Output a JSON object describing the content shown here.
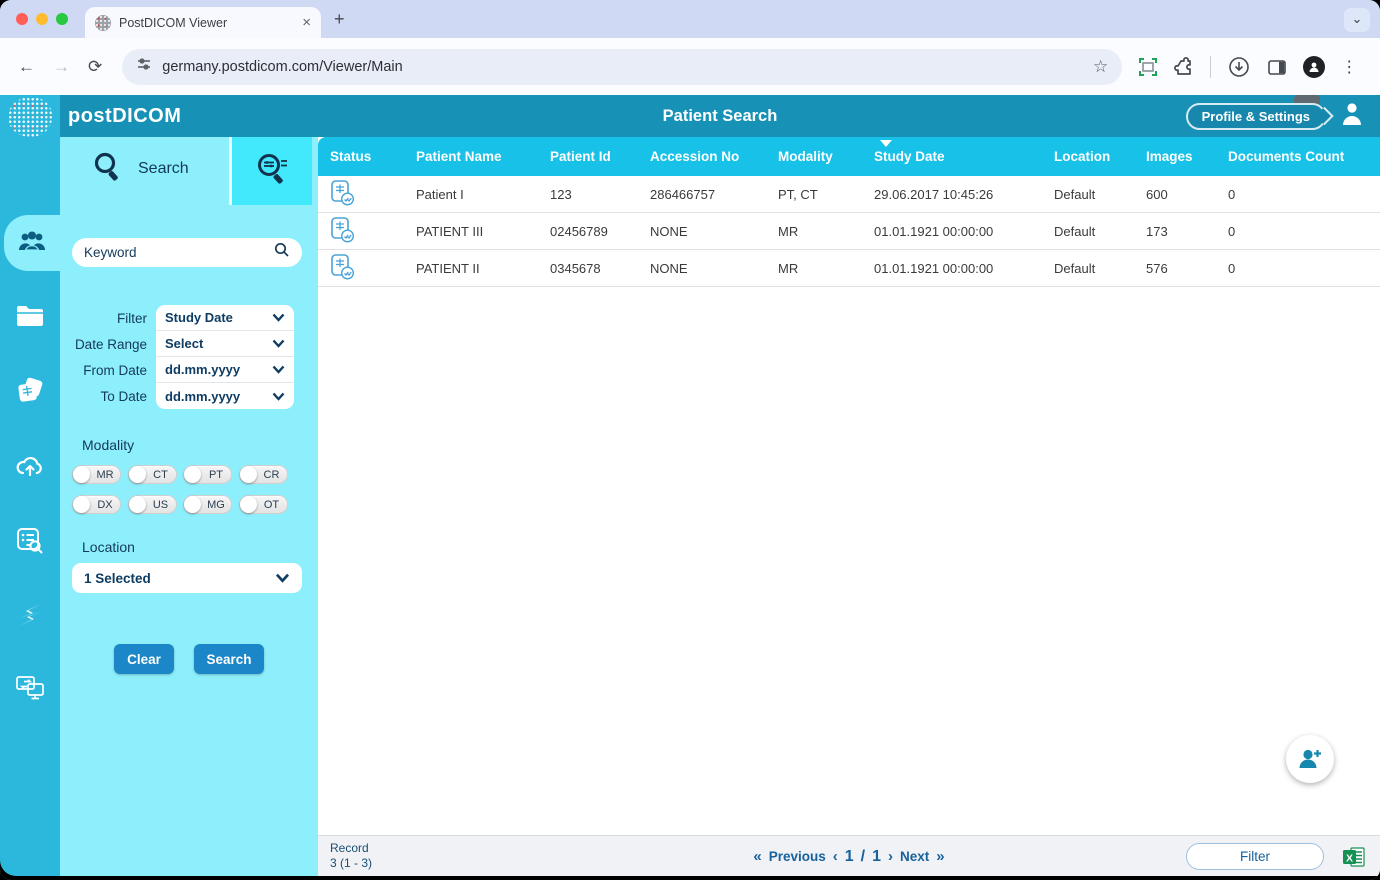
{
  "browser": {
    "tab_title": "PostDICOM Viewer",
    "url": "germany.postdicom.com/Viewer/Main",
    "new_tab": "+",
    "close_tab": "×",
    "back": "←",
    "forward": "→",
    "reload": "⟳",
    "star": "☆",
    "menu_dots": "⋮",
    "chevron": "⌄"
  },
  "header": {
    "logo": "postDICOM",
    "title": "Patient Search",
    "profile_tooltip": "Profile & Settings"
  },
  "sidebar": {
    "active_item": "patients",
    "items": [
      "patients",
      "folders",
      "studies",
      "cloud-upload",
      "worklist",
      "sync",
      "share-viewer"
    ]
  },
  "search_panel": {
    "tab_label": "Search",
    "keyword_placeholder": "Keyword",
    "filter_rows": [
      {
        "label": "Filter",
        "value": "Study Date"
      },
      {
        "label": "Date Range",
        "value": "Select"
      },
      {
        "label": "From Date",
        "value": "dd.mm.yyyy"
      },
      {
        "label": "To Date",
        "value": "dd.mm.yyyy"
      }
    ],
    "modality_label": "Modality",
    "modality_options": [
      "MR",
      "CT",
      "PT",
      "CR",
      "DX",
      "US",
      "MG",
      "OT"
    ],
    "location_label": "Location",
    "location_value": "1 Selected",
    "clear_label": "Clear",
    "search_label": "Search"
  },
  "table": {
    "columns": [
      "Status",
      "Patient Name",
      "Patient Id",
      "Accession No",
      "Modality",
      "Study Date",
      "Location",
      "Images",
      "Documents Count"
    ],
    "sorted_column": "Study Date",
    "sort_direction": "desc",
    "rows": [
      {
        "patient_name": "Patient I",
        "patient_id": "123",
        "accession_no": "286466757",
        "modality": "PT, CT",
        "study_date": "29.06.2017 10:45:26",
        "location": "Default",
        "images": "600",
        "documents_count": "0"
      },
      {
        "patient_name": "PATIENT III",
        "patient_id": "02456789",
        "accession_no": "NONE",
        "modality": "MR",
        "study_date": "01.01.1921 00:00:00",
        "location": "Default",
        "images": "173",
        "documents_count": "0"
      },
      {
        "patient_name": "PATIENT II",
        "patient_id": "0345678",
        "accession_no": "NONE",
        "modality": "MR",
        "study_date": "01.01.1921 00:00:00",
        "location": "Default",
        "images": "576",
        "documents_count": "0"
      }
    ]
  },
  "footer": {
    "record_label": "Record",
    "record_range": "3 (1 - 3)",
    "first": "«",
    "prev_arrow": "‹",
    "next_arrow": "›",
    "last": "»",
    "previous_label": "Previous",
    "next_label": "Next",
    "current_page": "1",
    "page_separator": "/",
    "total_pages": "1",
    "filter_label": "Filter"
  },
  "colors": {
    "header_teal": "#1792b6",
    "sidebar_cyan": "#2bb8dc",
    "panel_cyan": "#8deffb",
    "active_tab_cyan": "#42e9fd",
    "table_header_cyan": "#18c1e8",
    "button_blue": "#1b86c8",
    "navy_text": "#14395a"
  }
}
